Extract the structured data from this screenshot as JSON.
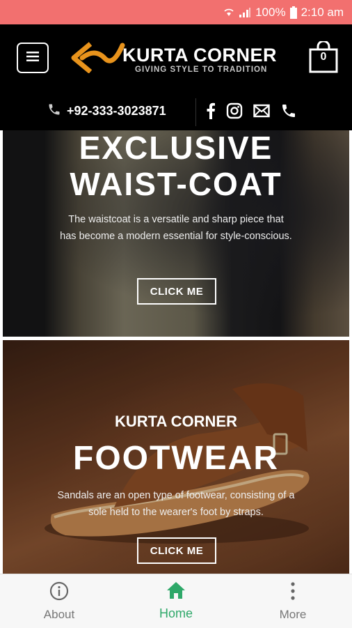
{
  "status_bar": {
    "battery": "100%",
    "time": "2:10 am"
  },
  "header": {
    "brand": "KURTA CORNER",
    "tagline": "GIVING STYLE TO TRADITION",
    "cart_count": "0",
    "phone": "+92-333-3023871",
    "social_icons": [
      "facebook-icon",
      "instagram-icon",
      "email-icon",
      "phone-icon"
    ]
  },
  "banners": [
    {
      "title_line1": "EXCLUSIVE",
      "title_line2": "WAIST-COAT",
      "description": "The waistcoat is a versatile and sharp piece that has become a modern essential for style-conscious.",
      "button": "CLICK ME"
    },
    {
      "subtitle": "KURTA CORNER",
      "title": "FOOTWEAR",
      "description": "Sandals are an open type of footwear, consisting of a sole held to the wearer's foot by straps.",
      "button": "CLICK ME"
    }
  ],
  "bottom_nav": [
    {
      "label": "About",
      "icon": "info-icon"
    },
    {
      "label": "Home",
      "icon": "home-icon",
      "active": true
    },
    {
      "label": "More",
      "icon": "more-vertical-icon"
    }
  ],
  "colors": {
    "status_bar": "#f2706f",
    "header_bg": "#000000",
    "logo_orange": "#e8931c",
    "active_nav": "#2ea869"
  }
}
